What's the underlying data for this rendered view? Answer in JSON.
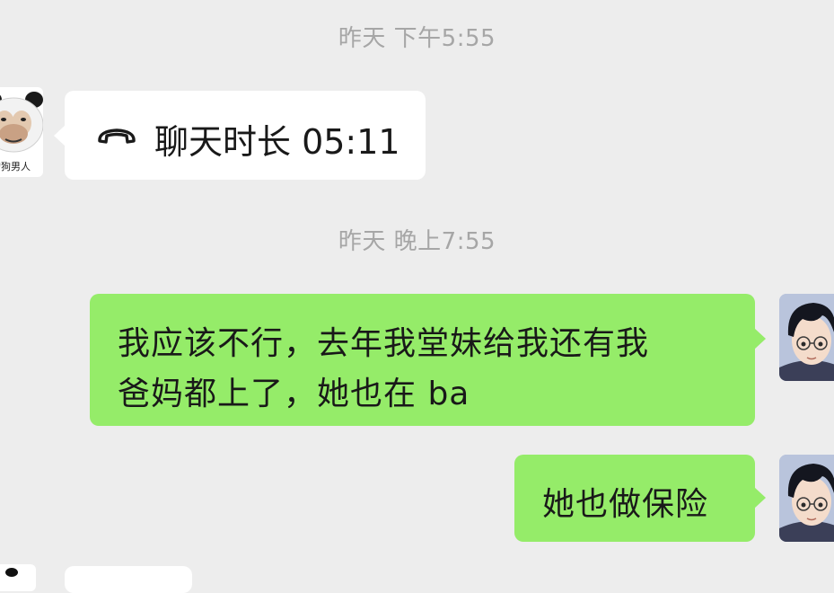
{
  "messages": {
    "timestamp_1": "昨天 下午5:55",
    "call": {
      "icon": "phone-hangup-icon",
      "text": "聊天时长 05:11"
    },
    "timestamp_2": "昨天 晚上7:55",
    "outgoing_1": {
      "line_1": "我应该不行，去年我堂妹给我还有我",
      "line_2": "爸妈都上了，她也在 ba"
    },
    "outgoing_2": {
      "text": "她也做保险"
    }
  },
  "contacts": {
    "left_avatar_caption": "的狗男人"
  },
  "colors": {
    "background": "#ededed",
    "outgoing_bubble": "#95ec69",
    "incoming_bubble": "#ffffff",
    "timestamp": "#a6a6a6"
  }
}
